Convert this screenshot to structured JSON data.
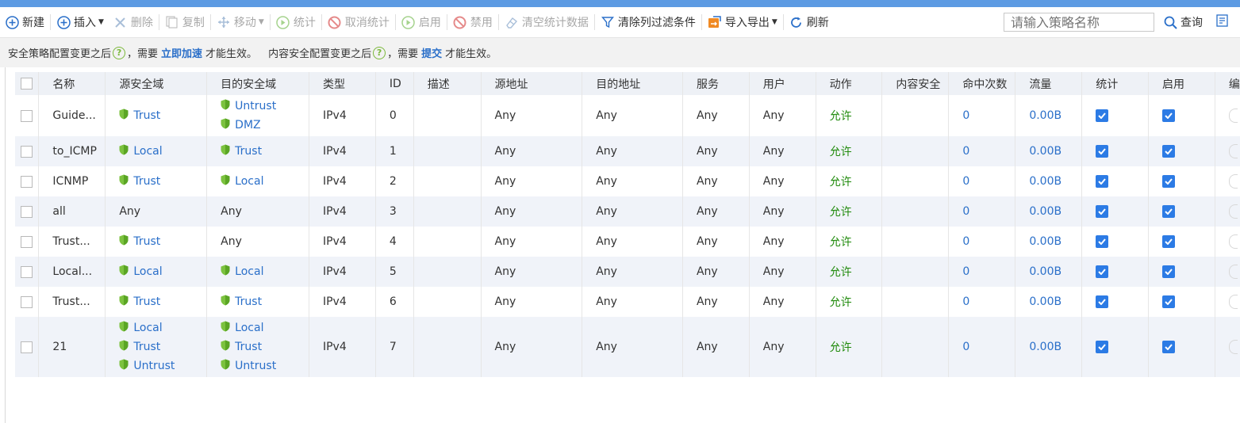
{
  "toolbar": {
    "new": "新建",
    "insert": "插入",
    "delete": "删除",
    "copy": "复制",
    "move": "移动",
    "stats": "统计",
    "cancel_stats": "取消统计",
    "enable": "启用",
    "disable": "禁用",
    "clear_stats": "清空统计数据",
    "clear_filters": "清除列过滤条件",
    "import_export": "导入导出",
    "refresh": "刷新",
    "search_placeholder": "请输入策略名称",
    "query": "查询"
  },
  "notice": {
    "p1": "安全策略配置变更之后",
    "p2": "，需要",
    "link1": "立即加速",
    "p3": "才能生效。",
    "p4": "内容安全配置变更之后",
    "p5": "，需要",
    "link2": "提交",
    "p6": "才能生效。"
  },
  "table": {
    "columns": [
      "名称",
      "源安全域",
      "目的安全域",
      "类型",
      "ID",
      "描述",
      "源地址",
      "目的地址",
      "服务",
      "用户",
      "动作",
      "内容安全",
      "命中次数",
      "流量",
      "统计",
      "启用",
      "编"
    ],
    "rows": [
      {
        "name": "Guide...",
        "src": [
          "Trust"
        ],
        "dst": [
          "Untrust",
          "DMZ"
        ],
        "type": "IPv4",
        "id": "0",
        "desc": "",
        "srcaddr": "Any",
        "dstaddr": "Any",
        "service": "Any",
        "user": "Any",
        "action": "允许",
        "content": "",
        "hits": "0",
        "traffic": "0.00B"
      },
      {
        "name": "to_ICMP",
        "src": [
          "Local"
        ],
        "dst": [
          "Trust"
        ],
        "type": "IPv4",
        "id": "1",
        "desc": "",
        "srcaddr": "Any",
        "dstaddr": "Any",
        "service": "Any",
        "user": "Any",
        "action": "允许",
        "content": "",
        "hits": "0",
        "traffic": "0.00B"
      },
      {
        "name": "ICNMP",
        "src": [
          "Trust"
        ],
        "dst": [
          "Local"
        ],
        "type": "IPv4",
        "id": "2",
        "desc": "",
        "srcaddr": "Any",
        "dstaddr": "Any",
        "service": "Any",
        "user": "Any",
        "action": "允许",
        "content": "",
        "hits": "0",
        "traffic": "0.00B"
      },
      {
        "name": "all",
        "src": "Any",
        "dst": "Any",
        "type": "IPv4",
        "id": "3",
        "desc": "",
        "srcaddr": "Any",
        "dstaddr": "Any",
        "service": "Any",
        "user": "Any",
        "action": "允许",
        "content": "",
        "hits": "0",
        "traffic": "0.00B"
      },
      {
        "name": "Trust...",
        "src": [
          "Trust"
        ],
        "dst": "Any",
        "type": "IPv4",
        "id": "4",
        "desc": "",
        "srcaddr": "Any",
        "dstaddr": "Any",
        "service": "Any",
        "user": "Any",
        "action": "允许",
        "content": "",
        "hits": "0",
        "traffic": "0.00B"
      },
      {
        "name": "Local...",
        "src": [
          "Local"
        ],
        "dst": [
          "Local"
        ],
        "type": "IPv4",
        "id": "5",
        "desc": "",
        "srcaddr": "Any",
        "dstaddr": "Any",
        "service": "Any",
        "user": "Any",
        "action": "允许",
        "content": "",
        "hits": "0",
        "traffic": "0.00B"
      },
      {
        "name": "Trust...",
        "src": [
          "Trust"
        ],
        "dst": [
          "Trust"
        ],
        "type": "IPv4",
        "id": "6",
        "desc": "",
        "srcaddr": "Any",
        "dstaddr": "Any",
        "service": "Any",
        "user": "Any",
        "action": "允许",
        "content": "",
        "hits": "0",
        "traffic": "0.00B"
      },
      {
        "name": "21",
        "src": [
          "Local",
          "Trust",
          "Untrust"
        ],
        "dst": [
          "Local",
          "Trust",
          "Untrust"
        ],
        "type": "IPv4",
        "id": "7",
        "desc": "",
        "srcaddr": "Any",
        "dstaddr": "Any",
        "service": "Any",
        "user": "Any",
        "action": "允许",
        "content": "",
        "hits": "0",
        "traffic": "0.00B"
      }
    ]
  }
}
